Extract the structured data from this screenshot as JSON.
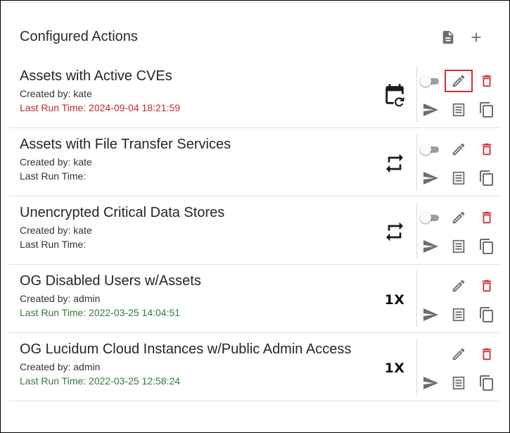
{
  "header": {
    "title": "Configured Actions",
    "doc_icon": "document-icon",
    "add_icon": "plus-icon"
  },
  "colors": {
    "delete": "#d32f2f",
    "last_run_red": "#c62828",
    "last_run_green": "#2e7d32",
    "icon_grey": "#6d6d6d"
  },
  "actions": [
    {
      "title": "Assets with Active CVEs",
      "created_by": "Created by: kate",
      "last_run": "Last Run Time: 2024-09-04 18:21:59",
      "last_run_status": "red",
      "schedule_icon": "calendar-repeat-icon",
      "has_toggle": true,
      "edit_highlighted": true
    },
    {
      "title": "Assets with File Transfer Services",
      "created_by": "Created by: kate",
      "last_run": "Last Run Time:",
      "last_run_status": "none",
      "schedule_icon": "repeat-icon",
      "has_toggle": true,
      "edit_highlighted": false
    },
    {
      "title": "Unencrypted Critical Data Stores",
      "created_by": "Created by: kate",
      "last_run": "Last Run Time:",
      "last_run_status": "none",
      "schedule_icon": "repeat-icon",
      "has_toggle": true,
      "edit_highlighted": false
    },
    {
      "title": "OG Disabled Users w/Assets",
      "created_by": "Created by: admin",
      "last_run": "Last Run Time: 2022-03-25 14:04:51",
      "last_run_status": "green",
      "schedule_text": "1X",
      "has_toggle": false,
      "edit_highlighted": false
    },
    {
      "title": "OG Lucidum Cloud Instances w/Public Admin Access",
      "created_by": "Created by: admin",
      "last_run": "Last Run Time: 2022-03-25 12:58:24",
      "last_run_status": "green",
      "schedule_text": "1X",
      "has_toggle": false,
      "edit_highlighted": false
    }
  ]
}
